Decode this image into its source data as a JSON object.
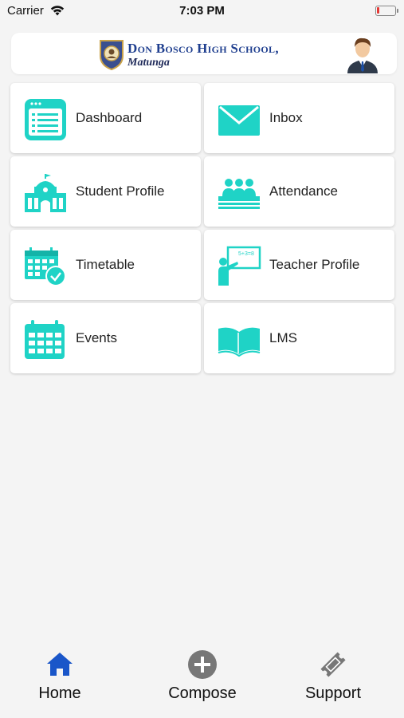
{
  "status_bar": {
    "carrier": "Carrier",
    "time": "7:03 PM"
  },
  "header": {
    "school_name": "Don Bosco High School,",
    "school_location": "Matunga"
  },
  "tiles": [
    {
      "label": "Dashboard",
      "icon": "dashboard-icon"
    },
    {
      "label": "Inbox",
      "icon": "envelope-icon"
    },
    {
      "label": "Student Profile",
      "icon": "school-building-icon"
    },
    {
      "label": "Attendance",
      "icon": "group-people-icon"
    },
    {
      "label": "Timetable",
      "icon": "calendar-clock-icon"
    },
    {
      "label": "Teacher Profile",
      "icon": "teacher-board-icon"
    },
    {
      "label": "Events",
      "icon": "calendar-icon"
    },
    {
      "label": "LMS",
      "icon": "open-book-icon"
    }
  ],
  "tabbar": {
    "items": [
      {
        "label": "Home",
        "icon": "home-icon",
        "active": true
      },
      {
        "label": "Compose",
        "icon": "plus-circle-icon"
      },
      {
        "label": "Support",
        "icon": "ticket-icon"
      }
    ]
  },
  "colors": {
    "accent": "#1fd3c6",
    "active_tab": "#1a56c9",
    "inactive_tab": "#777777",
    "brand_text": "#1f3f8f"
  }
}
